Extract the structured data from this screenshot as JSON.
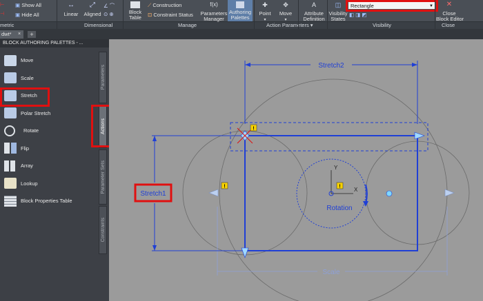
{
  "ribbon": {
    "parametric_partial": "metric",
    "show_all": "Show All",
    "hide_all": "Hide All",
    "linear": "Linear",
    "aligned": "Aligned",
    "block_table": "Block\nTable",
    "block_table_l1": "Block",
    "block_table_l2": "Table",
    "construction": "Construction",
    "constraint_status": "Constraint Status",
    "parameters_manager_l1": "Parameters",
    "parameters_manager_l2": "Manager",
    "authoring_palettes_l1": "Authoring",
    "authoring_palettes_l2": "Palettes",
    "point": "Point",
    "move": "Move",
    "attribute_def_l1": "Attribute",
    "attribute_def_l2": "Definition",
    "visibility_states_l1": "Visibility",
    "visibility_states_l2": "States",
    "visibility_dropdown_value": "Rectangle",
    "close_block_editor_l1": "Close",
    "close_block_editor_l2": "Block Editor",
    "panels": {
      "dimensional": "Dimensional",
      "manage": "Manage",
      "action_parameters": "Action Parameters ▾",
      "visibility": "Visibility",
      "close": "Close"
    }
  },
  "doc_tab": {
    "label": "dwt*",
    "close": "×",
    "new": "+"
  },
  "palette": {
    "title": "BLOCK AUTHORING PALETTES - ...",
    "items": [
      {
        "label": "Move",
        "icon": "move-icon"
      },
      {
        "label": "Scale",
        "icon": "scale-icon"
      },
      {
        "label": "Stretch",
        "icon": "stretch-icon"
      },
      {
        "label": "Polar Stretch",
        "icon": "polar-stretch-icon"
      },
      {
        "label": "Rotate",
        "icon": "rotate-icon"
      },
      {
        "label": "Flip",
        "icon": "flip-icon"
      },
      {
        "label": "Array",
        "icon": "array-icon"
      },
      {
        "label": "Lookup",
        "icon": "lookup-icon"
      },
      {
        "label": "Block Properties Table",
        "icon": "block-properties-table-icon"
      }
    ],
    "tabs": [
      "Parameters",
      "Actions",
      "Parameter Sets",
      "Constraints"
    ],
    "active_tab": "Actions"
  },
  "canvas": {
    "stretch2_label": "Stretch2",
    "stretch1_label": "Stretch1",
    "rotation_label": "Rotation",
    "scale_label": "Scale",
    "y_axis": "Y",
    "x_axis": "X",
    "warning_glyph": "!"
  },
  "colors": {
    "ribbon_bg": "#4a4f56",
    "palette_bg": "#3d4046",
    "canvas_bg": "#9b9b9b",
    "blue_param": "#1f3fd6",
    "highlight_red": "#e01010"
  }
}
